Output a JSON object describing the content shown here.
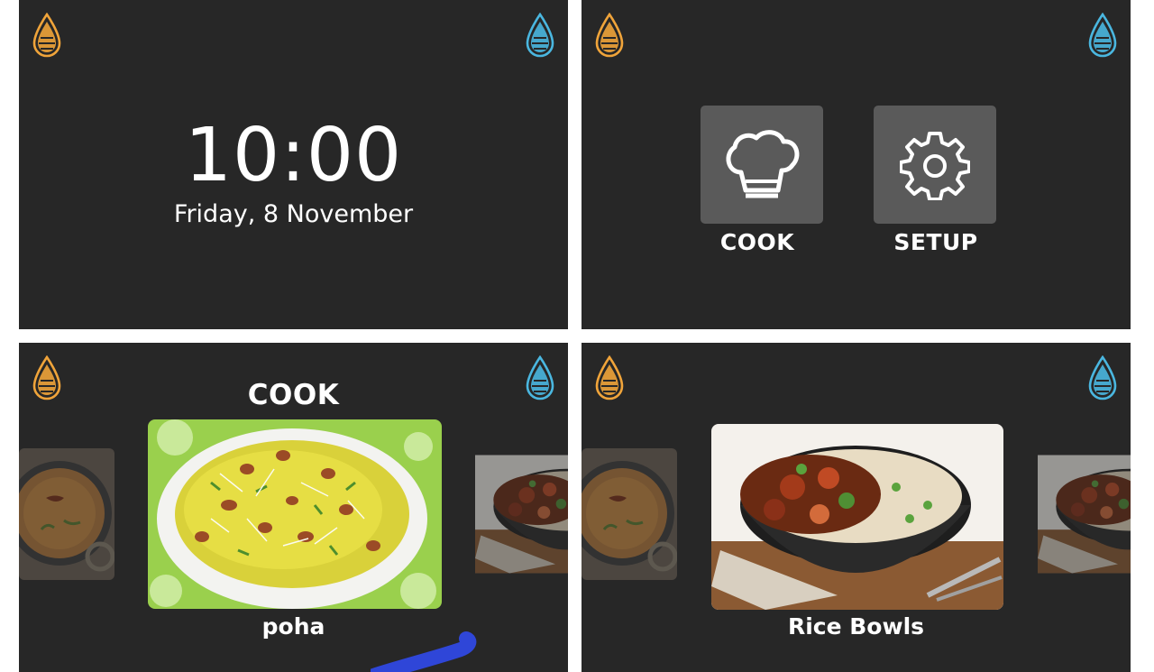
{
  "clock_screen": {
    "time": "10:00",
    "date": "Friday, 8 November",
    "icons": [
      "orange-drop-icon",
      "blue-drop-icon"
    ]
  },
  "menu_screen": {
    "items": [
      {
        "label": "COOK",
        "icon": "chef-hat-icon"
      },
      {
        "label": "SETUP",
        "icon": "gear-icon"
      }
    ]
  },
  "cook_screen": {
    "title": "COOK",
    "selected_dish": "poha",
    "carousel": [
      "curry-image",
      "poha-image",
      "rice-bowl-image"
    ]
  },
  "rice_screen": {
    "selected_dish": "Rice Bowls",
    "carousel": [
      "curry-image",
      "rice-bowl-image",
      "rice-bowl-image"
    ]
  },
  "colors": {
    "panel_bg": "#272727",
    "drop_orange": "#f0a43a",
    "drop_blue": "#4ab7e0",
    "tile_bg": "#5a5a5a",
    "touch_stroke": "#2f46d8"
  }
}
